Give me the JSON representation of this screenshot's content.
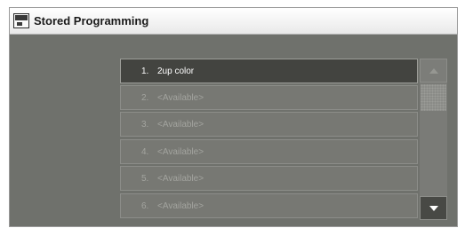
{
  "window": {
    "title": "Stored Programming",
    "icon": "stored-programming-icon"
  },
  "list": {
    "items": [
      {
        "number": "1.",
        "label": "2up color",
        "selected": true
      },
      {
        "number": "2.",
        "label": "<Available>",
        "selected": false
      },
      {
        "number": "3.",
        "label": "<Available>",
        "selected": false
      },
      {
        "number": "4.",
        "label": "<Available>",
        "selected": false
      },
      {
        "number": "5.",
        "label": "<Available>",
        "selected": false
      },
      {
        "number": "6.",
        "label": "<Available>",
        "selected": false
      }
    ]
  },
  "scrollbar": {
    "up_icon": "triangle-up-icon",
    "down_icon": "triangle-down-icon"
  },
  "colors": {
    "background": "#6f716c",
    "selected_row": "#434440",
    "available_text": "#a3a49f"
  }
}
